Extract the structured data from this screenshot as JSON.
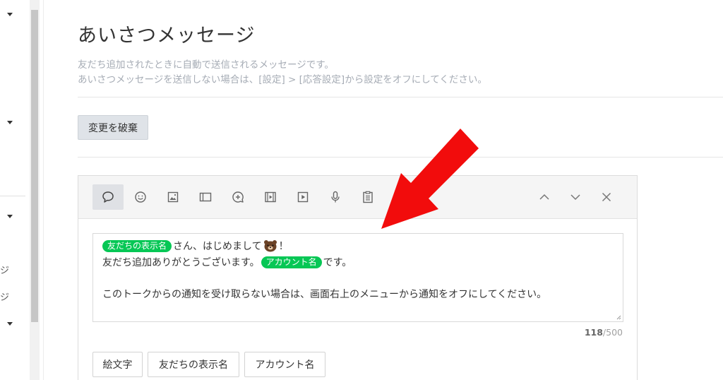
{
  "sidebar": {
    "fragments": [
      "ジ",
      "ジ"
    ]
  },
  "page": {
    "title": "あいさつメッセージ",
    "description_1": "友だち追加されたときに自動で送信されるメッセージです。",
    "description_2": "あいさつメッセージを送信しない場合は、[設定] > [応答設定]から設定をオフにしてください。"
  },
  "actions": {
    "discard_label": "変更を破棄"
  },
  "editor": {
    "toolbar_icons": [
      "speech-bubble-icon",
      "emoji-icon",
      "image-icon",
      "card-icon",
      "chat-plus-icon",
      "video-icon",
      "play-icon",
      "microphone-icon",
      "clipboard-icon",
      "chevron-up-icon",
      "chevron-down-icon",
      "close-icon"
    ],
    "message": {
      "tag_display_name": "友だちの表示名",
      "line1_text": "さん、はじめまして",
      "line1_end": "！",
      "line2_text": "友だち追加ありがとうございます。",
      "tag_account_name": "アカウント名",
      "line2_end": "です。",
      "line4_text": "このトークからの通知を受け取らない場合は、画面右上のメニューから通知をオフにしてください。"
    },
    "counter_current": "118",
    "counter_max": "/500",
    "insert_buttons": {
      "emoji": "絵文字",
      "display_name": "友だちの表示名",
      "account_name": "アカウント名"
    }
  },
  "colors": {
    "tag_green": "#06c755",
    "arrow_red": "#f20c0c"
  }
}
